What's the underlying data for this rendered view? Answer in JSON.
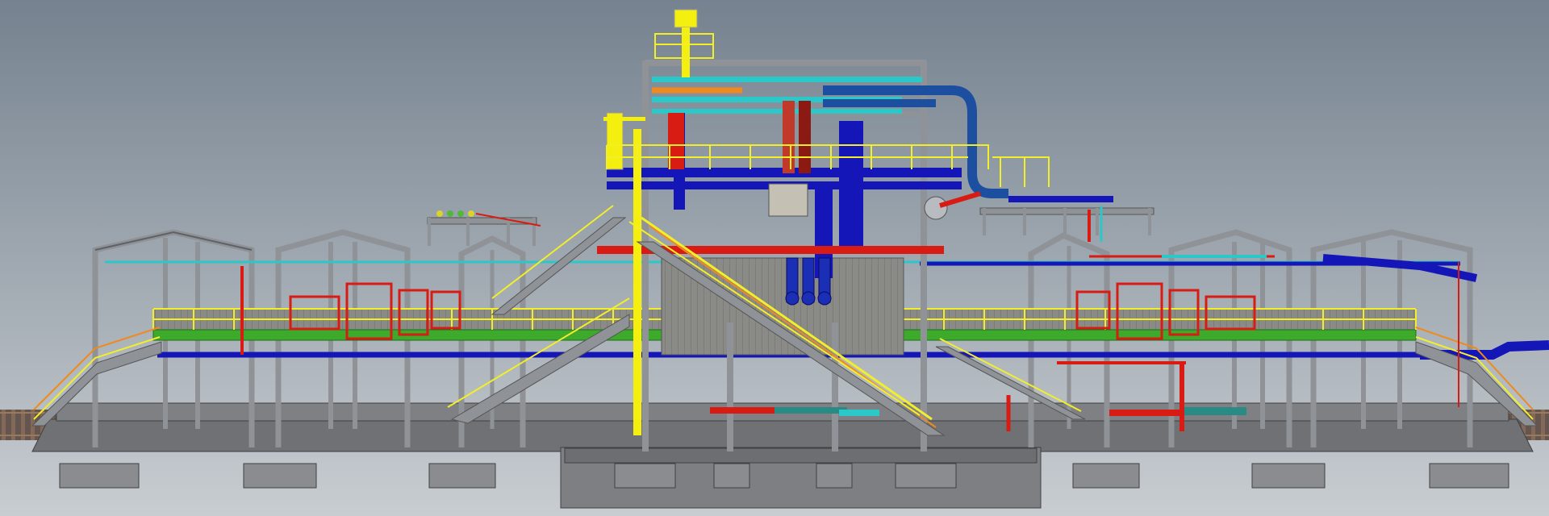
{
  "scene": {
    "kind": "3d-plant-model-viewport",
    "colors": {
      "sky_top": "#75828f",
      "sky_bottom": "#c8cdd1",
      "steel": "#8f9296",
      "steel_dark": "#5e6266",
      "concrete": "#7d7f82",
      "concrete_dark": "#5a5c5f",
      "handrail": "#f2ee2a",
      "walkway": "#3daa2c",
      "pipe_blue": "#1416b8",
      "pipe_red": "#d81b13",
      "pipe_cyan": "#2ac8c8",
      "pipe_orange": "#ee8a1e",
      "vessel_yellow": "#f5ef10",
      "rail": "#6b4a34"
    },
    "components": [
      "left-pipe-rack-frames",
      "right-pipe-rack-frames",
      "central-process-module",
      "exhaust-stack",
      "green-walkway-deck",
      "stairs",
      "concrete-foundation",
      "rail-track"
    ]
  }
}
